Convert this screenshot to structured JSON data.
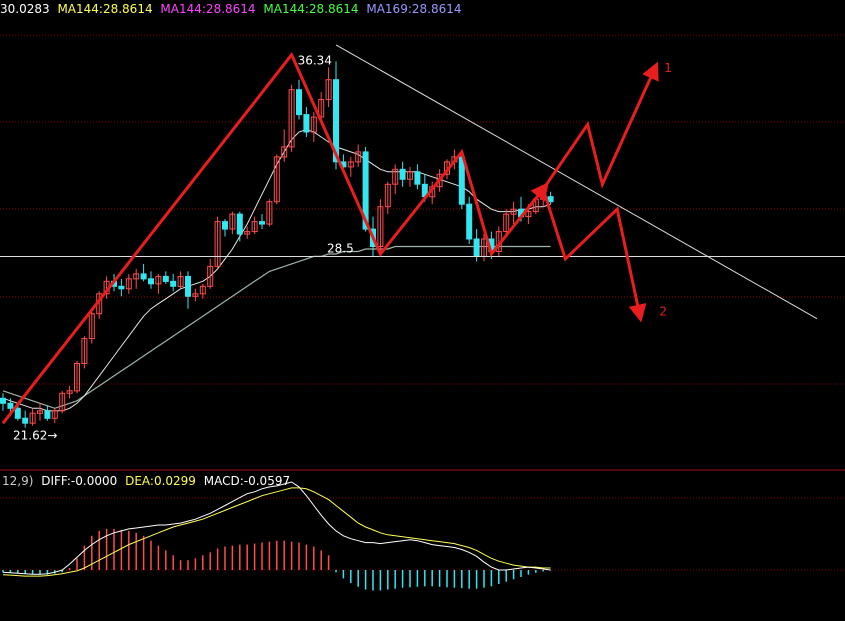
{
  "legend": {
    "ma_items": [
      {
        "text": "30.0283",
        "color": "#ffffff"
      },
      {
        "text": "MA144:28.8614",
        "color": "#ffff55"
      },
      {
        "text": "MA144:28.8614",
        "color": "#ff44ff"
      },
      {
        "text": "MA144:28.8614",
        "color": "#44ff44"
      },
      {
        "text": "MA169:28.8614",
        "color": "#9999ff"
      }
    ]
  },
  "macd_legend": {
    "items": [
      {
        "text": "12,9)",
        "color": "#cccccc"
      },
      {
        "text": "DIFF:-0.0000",
        "color": "#ffffff"
      },
      {
        "text": "DEA:0.0299",
        "color": "#ffff55"
      },
      {
        "text": "MACD:-0.0597",
        "color": "#ffffff"
      }
    ]
  },
  "colors": {
    "background": "#000000",
    "up_candle": "#ff4d4d",
    "down_candle": "#33e6f0",
    "grid": "#8b0000",
    "arrow": "#e81e1e",
    "trendline": "#dddddd",
    "ma_short": "#e8e8e8",
    "ma_long": "#9fb5a8",
    "macd_dea": "#ffff55",
    "macd_diff": "#ffffff"
  },
  "chart_data": {
    "type": "candlestick",
    "price_range": [
      20.0,
      38.0
    ],
    "annotations": {
      "high_label": "36.34",
      "low_label": "21.62→",
      "support_label": "28.5",
      "scenario_1": "1",
      "scenario_2": "2"
    },
    "support_level": 28.5,
    "candles": [
      [
        22.8,
        23.0,
        22.3,
        22.6
      ],
      [
        22.6,
        22.8,
        22.1,
        22.4
      ],
      [
        22.4,
        22.6,
        21.9,
        22.0
      ],
      [
        22.0,
        22.3,
        21.62,
        21.8
      ],
      [
        21.8,
        22.4,
        21.7,
        22.2
      ],
      [
        22.2,
        22.6,
        21.9,
        22.3
      ],
      [
        22.3,
        22.5,
        21.9,
        22.0
      ],
      [
        22.0,
        22.4,
        21.8,
        22.3
      ],
      [
        22.3,
        23.1,
        22.2,
        23.0
      ],
      [
        23.0,
        23.3,
        22.8,
        23.1
      ],
      [
        23.1,
        24.3,
        23.0,
        24.2
      ],
      [
        24.2,
        25.3,
        24.0,
        25.2
      ],
      [
        25.2,
        26.3,
        25.0,
        26.2
      ],
      [
        26.2,
        27.1,
        26.0,
        27.0
      ],
      [
        27.0,
        27.7,
        26.8,
        27.5
      ],
      [
        27.5,
        27.8,
        27.1,
        27.3
      ],
      [
        27.3,
        27.6,
        26.9,
        27.2
      ],
      [
        27.2,
        27.8,
        27.0,
        27.6
      ],
      [
        27.6,
        28.0,
        27.2,
        27.8
      ],
      [
        27.8,
        28.2,
        27.5,
        27.6
      ],
      [
        27.6,
        27.9,
        27.2,
        27.4
      ],
      [
        27.4,
        27.8,
        27.0,
        27.7
      ],
      [
        27.7,
        27.9,
        27.4,
        27.5
      ],
      [
        27.5,
        27.8,
        27.1,
        27.3
      ],
      [
        27.3,
        27.9,
        27.2,
        27.7
      ],
      [
        27.7,
        27.9,
        26.4,
        26.9
      ],
      [
        26.9,
        27.2,
        26.7,
        27.0
      ],
      [
        27.0,
        27.4,
        26.8,
        27.3
      ],
      [
        27.3,
        28.4,
        27.2,
        28.1
      ],
      [
        28.1,
        30.1,
        28.0,
        29.9
      ],
      [
        29.9,
        30.0,
        29.3,
        29.6
      ],
      [
        29.6,
        30.3,
        29.4,
        30.2
      ],
      [
        30.2,
        30.3,
        29.1,
        29.4
      ],
      [
        29.4,
        29.7,
        29.2,
        29.5
      ],
      [
        29.5,
        30.1,
        29.4,
        29.9
      ],
      [
        29.9,
        30.2,
        29.6,
        29.8
      ],
      [
        29.8,
        30.8,
        29.7,
        30.7
      ],
      [
        30.7,
        32.6,
        30.6,
        32.5
      ],
      [
        32.5,
        33.6,
        32.3,
        32.9
      ],
      [
        32.9,
        35.4,
        32.7,
        35.2
      ],
      [
        35.2,
        35.6,
        34.0,
        34.2
      ],
      [
        34.2,
        34.5,
        33.3,
        33.5
      ],
      [
        33.5,
        34.3,
        33.1,
        34.1
      ],
      [
        34.1,
        35.1,
        33.9,
        34.8
      ],
      [
        34.8,
        36.1,
        34.5,
        35.6
      ],
      [
        35.6,
        36.34,
        32.0,
        32.3
      ],
      [
        32.3,
        32.6,
        31.9,
        32.1
      ],
      [
        32.1,
        32.5,
        31.7,
        32.3
      ],
      [
        32.3,
        33.0,
        32.1,
        32.7
      ],
      [
        32.7,
        32.9,
        29.5,
        29.6
      ],
      [
        29.6,
        30.1,
        28.5,
        28.9
      ],
      [
        28.9,
        30.8,
        28.7,
        30.5
      ],
      [
        30.5,
        31.5,
        30.2,
        31.4
      ],
      [
        31.4,
        32.2,
        31.0,
        32.0
      ],
      [
        32.0,
        32.3,
        31.3,
        31.6
      ],
      [
        31.6,
        32.1,
        31.3,
        31.9
      ],
      [
        31.9,
        32.2,
        31.2,
        31.4
      ],
      [
        31.4,
        31.8,
        30.7,
        30.9
      ],
      [
        30.9,
        31.5,
        30.6,
        31.3
      ],
      [
        31.3,
        32.0,
        31.1,
        31.8
      ],
      [
        31.8,
        32.4,
        31.6,
        32.3
      ],
      [
        32.3,
        32.8,
        32.0,
        32.5
      ],
      [
        32.5,
        32.6,
        30.4,
        30.6
      ],
      [
        30.6,
        30.9,
        29.0,
        29.2
      ],
      [
        29.2,
        29.6,
        28.3,
        28.5
      ],
      [
        28.5,
        29.4,
        28.3,
        29.2
      ],
      [
        29.2,
        29.5,
        28.4,
        28.7
      ],
      [
        28.7,
        29.7,
        28.5,
        29.5
      ],
      [
        29.5,
        30.4,
        29.3,
        30.2
      ],
      [
        30.2,
        30.7,
        29.8,
        30.4
      ],
      [
        30.4,
        30.9,
        29.9,
        30.1
      ],
      [
        30.1,
        30.6,
        29.8,
        30.3
      ],
      [
        30.3,
        30.9,
        30.2,
        30.8
      ],
      [
        30.8,
        31.2,
        30.5,
        30.9
      ],
      [
        30.9,
        31.1,
        30.6,
        30.7
      ]
    ],
    "ma_short": [
      22.8,
      22.7,
      22.6,
      22.5,
      22.4,
      22.4,
      22.3,
      22.3,
      22.3,
      22.4,
      22.6,
      22.9,
      23.3,
      23.7,
      24.1,
      24.5,
      24.9,
      25.3,
      25.7,
      26.1,
      26.4,
      26.6,
      26.8,
      27.0,
      27.2,
      27.3,
      27.4,
      27.5,
      27.7,
      28.0,
      28.4,
      28.8,
      29.3,
      29.8,
      30.4,
      31.0,
      31.6,
      32.2,
      32.7,
      33.2,
      33.5,
      33.6,
      33.5,
      33.3,
      33.1,
      32.9,
      32.8,
      32.7,
      32.6,
      32.4,
      32.2,
      32.0,
      31.9,
      31.9,
      31.9,
      31.9,
      31.9,
      31.8,
      31.7,
      31.6,
      31.5,
      31.4,
      31.3,
      31.1,
      30.8,
      30.6,
      30.4,
      30.3,
      30.3,
      30.3,
      30.4,
      30.4,
      30.5,
      30.5,
      30.6
    ],
    "ma_long": [
      23.1,
      23.0,
      22.9,
      22.8,
      22.7,
      22.6,
      22.5,
      22.4,
      22.5,
      22.6,
      22.7,
      22.9,
      23.1,
      23.3,
      23.5,
      23.7,
      23.9,
      24.1,
      24.3,
      24.5,
      24.7,
      24.9,
      25.1,
      25.3,
      25.5,
      25.7,
      25.9,
      26.1,
      26.3,
      26.5,
      26.7,
      26.9,
      27.1,
      27.3,
      27.5,
      27.7,
      27.9,
      28.0,
      28.1,
      28.2,
      28.3,
      28.4,
      28.5,
      28.5,
      28.6,
      28.6,
      28.7,
      28.7,
      28.7,
      28.8,
      28.8,
      28.8,
      28.8,
      28.9,
      28.9,
      28.9,
      28.9,
      28.9,
      28.9,
      28.9,
      28.9,
      28.9,
      28.9,
      28.9,
      28.9,
      28.9,
      28.9,
      28.9,
      28.9,
      28.9,
      28.9,
      28.9,
      28.9,
      28.9,
      28.9
    ],
    "scenario_paths": {
      "main_swing": [
        [
          0,
          21.8
        ],
        [
          39,
          36.6
        ],
        [
          51,
          28.6
        ],
        [
          62,
          32.7
        ],
        [
          66,
          28.6
        ],
        [
          73,
          31.2
        ]
      ],
      "scenario_1": [
        [
          73,
          31.2
        ],
        [
          79,
          33.8
        ],
        [
          81,
          31.4
        ],
        [
          88,
          36.0
        ]
      ],
      "scenario_2": [
        [
          73,
          31.2
        ],
        [
          76,
          28.4
        ],
        [
          83,
          30.4
        ],
        [
          86,
          26.2
        ]
      ]
    },
    "resistance_line": {
      "from": [
        45,
        37.0
      ],
      "to": [
        110,
        26.0
      ]
    },
    "macd": {
      "range": [
        -0.9,
        0.9
      ],
      "histogram": [
        -0.05,
        -0.06,
        -0.07,
        -0.08,
        -0.09,
        -0.1,
        -0.1,
        -0.08,
        -0.05,
        0.02,
        0.12,
        0.25,
        0.35,
        0.4,
        0.42,
        0.42,
        0.41,
        0.4,
        0.38,
        0.35,
        0.3,
        0.25,
        0.2,
        0.15,
        0.1,
        0.1,
        0.12,
        0.15,
        0.18,
        0.22,
        0.24,
        0.25,
        0.26,
        0.26,
        0.27,
        0.28,
        0.29,
        0.3,
        0.3,
        0.29,
        0.28,
        0.26,
        0.24,
        0.2,
        0.15,
        -0.05,
        -0.18,
        -0.28,
        -0.36,
        -0.42,
        -0.44,
        -0.44,
        -0.42,
        -0.4,
        -0.38,
        -0.37,
        -0.36,
        -0.35,
        -0.35,
        -0.36,
        -0.37,
        -0.38,
        -0.39,
        -0.4,
        -0.4,
        -0.38,
        -0.35,
        -0.3,
        -0.25,
        -0.2,
        -0.15,
        -0.1,
        -0.06,
        -0.03,
        -0.01
      ],
      "diff": [
        -0.05,
        -0.06,
        -0.07,
        -0.08,
        -0.09,
        -0.09,
        -0.08,
        -0.05,
        0.0,
        0.06,
        0.13,
        0.2,
        0.26,
        0.31,
        0.35,
        0.38,
        0.4,
        0.42,
        0.43,
        0.44,
        0.45,
        0.46,
        0.46,
        0.47,
        0.48,
        0.5,
        0.52,
        0.55,
        0.58,
        0.62,
        0.66,
        0.7,
        0.74,
        0.78,
        0.8,
        0.83,
        0.85,
        0.86,
        0.88,
        0.9,
        0.85,
        0.76,
        0.66,
        0.56,
        0.47,
        0.4,
        0.35,
        0.32,
        0.3,
        0.28,
        0.28,
        0.27,
        0.28,
        0.29,
        0.3,
        0.31,
        0.3,
        0.28,
        0.26,
        0.25,
        0.24,
        0.23,
        0.21,
        0.18,
        0.14,
        0.08,
        0.03,
        0.0,
        0.0,
        0.01,
        0.02,
        0.03,
        0.02,
        0.01,
        0.0
      ],
      "dea": [
        -0.1,
        -0.11,
        -0.12,
        -0.13,
        -0.13,
        -0.13,
        -0.12,
        -0.1,
        -0.08,
        -0.05,
        -0.02,
        0.02,
        0.06,
        0.1,
        0.14,
        0.18,
        0.22,
        0.26,
        0.29,
        0.32,
        0.35,
        0.38,
        0.41,
        0.44,
        0.46,
        0.48,
        0.5,
        0.52,
        0.55,
        0.58,
        0.61,
        0.64,
        0.67,
        0.7,
        0.73,
        0.76,
        0.78,
        0.8,
        0.82,
        0.84,
        0.84,
        0.83,
        0.8,
        0.76,
        0.72,
        0.66,
        0.6,
        0.54,
        0.48,
        0.44,
        0.41,
        0.38,
        0.36,
        0.35,
        0.34,
        0.33,
        0.32,
        0.31,
        0.3,
        0.29,
        0.28,
        0.27,
        0.25,
        0.23,
        0.2,
        0.16,
        0.12,
        0.09,
        0.07,
        0.05,
        0.04,
        0.03,
        0.03,
        0.02,
        0.02
      ]
    }
  }
}
